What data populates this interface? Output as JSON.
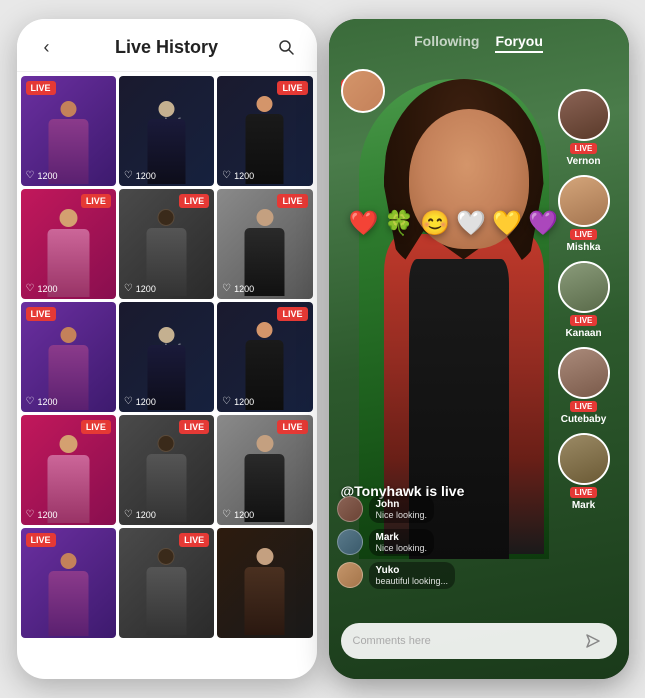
{
  "left_phone": {
    "header": {
      "back_label": "‹",
      "title": "Live History",
      "search_icon": "🔍"
    },
    "grid_cells": [
      {
        "id": 1,
        "color_class": "cell-purple",
        "live": true,
        "live_pos": "left",
        "likes": "1200",
        "has_figure": true,
        "fig_head_color": "#c4815a",
        "fig_body_color": "#8B3A8B"
      },
      {
        "id": 2,
        "color_class": "cell-dark",
        "live": false,
        "watermark": "val of\ntivity",
        "likes": "1200"
      },
      {
        "id": 3,
        "color_class": "cell-dark",
        "live": true,
        "live_pos": "right",
        "likes": "1200",
        "has_figure": true,
        "fig_head_color": "#d4956a",
        "fig_body_color": "#1a1a1a"
      },
      {
        "id": 4,
        "color_class": "cell-pink",
        "live": true,
        "live_pos": "right",
        "likes": "1200",
        "has_figure": true,
        "fig_head_color": "#d4a070",
        "fig_body_color": "#f8a0a0"
      },
      {
        "id": 5,
        "color_class": "cell-gray",
        "live": true,
        "live_pos": "right",
        "likes": "1200",
        "has_figure": true,
        "fig_head_color": "#3a2a1a",
        "fig_body_color": "#555"
      },
      {
        "id": 6,
        "color_class": "cell-lightgray",
        "live": true,
        "live_pos": "right",
        "likes": "1200",
        "has_figure": true,
        "fig_head_color": "#c4a080",
        "fig_body_color": "#2a2a2a"
      },
      {
        "id": 7,
        "color_class": "cell-purple",
        "live": true,
        "live_pos": "left",
        "likes": "1200",
        "has_figure": true,
        "fig_head_color": "#c4815a",
        "fig_body_color": "#8B3A8B"
      },
      {
        "id": 8,
        "color_class": "cell-dark",
        "live": false,
        "watermark": "val of\ntivity",
        "likes": "1200"
      },
      {
        "id": 9,
        "color_class": "cell-dark",
        "live": true,
        "live_pos": "right",
        "likes": "1200",
        "has_figure": true,
        "fig_head_color": "#d4956a",
        "fig_body_color": "#1a1a1a"
      },
      {
        "id": 10,
        "color_class": "cell-pink",
        "live": true,
        "live_pos": "right",
        "likes": "1200",
        "has_figure": true,
        "fig_head_color": "#d4a070",
        "fig_body_color": "#f8a0a0"
      },
      {
        "id": 11,
        "color_class": "cell-gray",
        "live": true,
        "live_pos": "right",
        "likes": "1200",
        "has_figure": true,
        "fig_head_color": "#3a2a1a",
        "fig_body_color": "#555"
      },
      {
        "id": 12,
        "color_class": "cell-lightgray",
        "live": true,
        "live_pos": "right",
        "likes": "1200",
        "has_figure": true,
        "fig_head_color": "#c4a080",
        "fig_body_color": "#2a2a2a"
      },
      {
        "id": 13,
        "color_class": "cell-purple",
        "live": true,
        "live_pos": "left",
        "likes": null
      },
      {
        "id": 14,
        "color_class": "cell-dark",
        "live": true,
        "live_pos": "right",
        "likes": null
      },
      {
        "id": 15,
        "color_class": "cell-darkbrown",
        "live": false,
        "likes": null
      }
    ]
  },
  "right_phone": {
    "tabs": {
      "following": "Following",
      "foryou": "Foryou"
    },
    "live_badge": "Live",
    "username_main": "@Tonyhawk is live",
    "reactions": [
      "❤️",
      "🍀",
      "😊",
      "🤍",
      "💛",
      "💜"
    ],
    "side_users": [
      {
        "name": "Vernon",
        "av_color": "#8B6355"
      },
      {
        "name": "Mishka",
        "av_color": "#C4956A"
      },
      {
        "name": "Kanaan",
        "av_color": "#7A8B6A"
      },
      {
        "name": "Cutebaby",
        "av_color": "#9A7A6A"
      },
      {
        "name": "Mark",
        "av_color": "#8B7A55"
      }
    ],
    "comments": [
      {
        "user": "John",
        "text": "Nice looking.",
        "av_color": "#8B6355"
      },
      {
        "user": "Mark",
        "text": "Nice looking.",
        "av_color": "#5A7A8B"
      },
      {
        "user": "Yuko",
        "text": "beautiful looking...",
        "av_color": "#C4956A"
      }
    ],
    "comment_placeholder": "Comments here",
    "send_icon": "➤"
  }
}
